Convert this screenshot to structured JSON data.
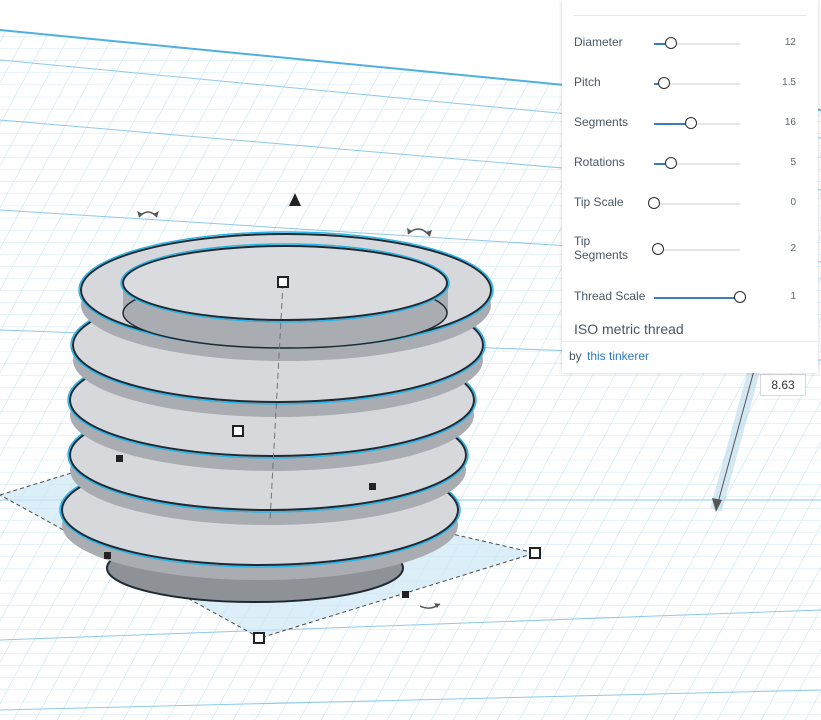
{
  "colors": {
    "grid_line": "#a8d0e6",
    "grid_accent": "#5fb0dc",
    "shape_fill": "#d6d8dc",
    "shape_side": "#a9adb2",
    "selection": "#2ab3e6",
    "slider_fill": "#3c7fb8"
  },
  "panel": {
    "params": [
      {
        "label": "Diameter",
        "value": "12",
        "fraction": 0.2
      },
      {
        "label": "Pitch",
        "value": "1.5",
        "fraction": 0.12
      },
      {
        "label": "Segments",
        "value": "16",
        "fraction": 0.43
      },
      {
        "label": "Rotations",
        "value": "5",
        "fraction": 0.2
      },
      {
        "label": "Tip Scale",
        "value": "0",
        "fraction": 0.0
      },
      {
        "label": "Tip\nSegments",
        "value": "2",
        "fraction": 0.05
      },
      {
        "label": "Thread Scale",
        "value": "1",
        "fraction": 1.0
      }
    ],
    "shape_title": "ISO metric thread",
    "byline_prefix": "by",
    "byline_author": "this tinkerer"
  },
  "viewport": {
    "height_dimension": "8.63"
  }
}
